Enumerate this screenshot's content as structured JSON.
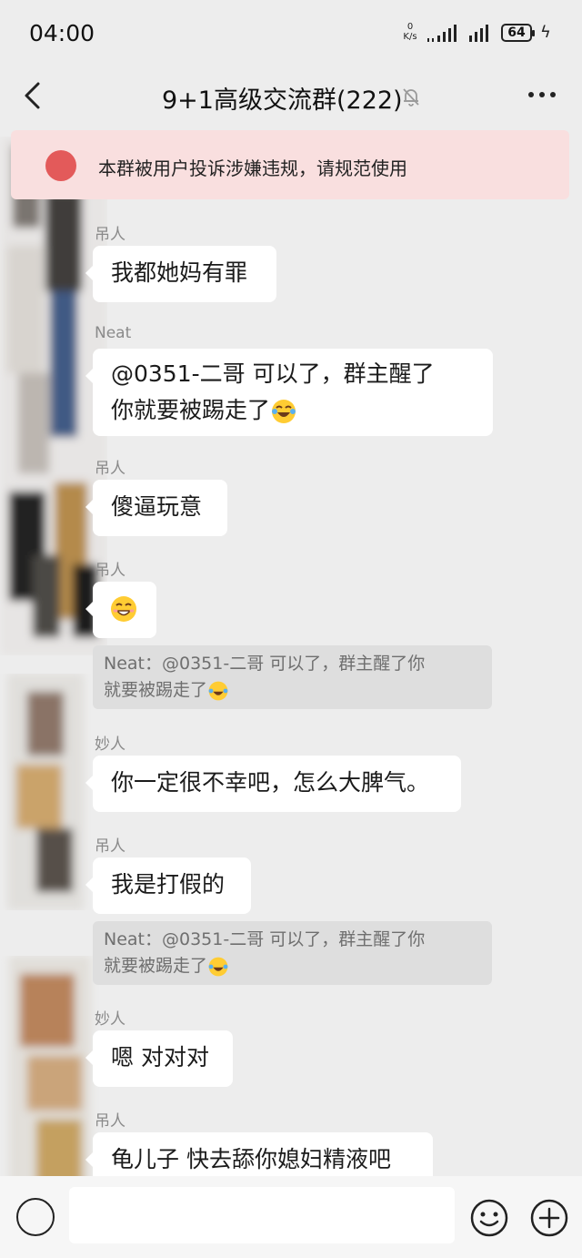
{
  "status": {
    "time": "04:00",
    "net_speed_value": "0",
    "net_speed_unit": "K/s",
    "battery": "64"
  },
  "header": {
    "title": "9+1高级交流群(222)"
  },
  "notice": {
    "text": "本群被用户投诉涉嫌违规，请规范使用"
  },
  "messages": [
    {
      "sender": "吊人",
      "text": "我都她妈有罪"
    },
    {
      "sender": "Neat",
      "line1": "@0351-二哥  可以了，群主醒了",
      "line2": "你就要被踢走了"
    },
    {
      "sender": "吊人",
      "text": "傻逼玩意"
    },
    {
      "sender": "吊人",
      "quote_line1": "Neat：@0351-二哥 可以了，群主醒了你",
      "quote_line2": "就要被踢走了"
    },
    {
      "sender": "妙人",
      "text": "你一定很不幸吧，怎么大脾气。"
    },
    {
      "sender": "吊人",
      "text": "我是打假的",
      "quote_line1": "Neat：@0351-二哥 可以了，群主醒了你",
      "quote_line2": "就要被踢走了"
    },
    {
      "sender": "妙人",
      "text": "嗯 对对对"
    },
    {
      "sender": "吊人",
      "text": "龟儿子 快去舔你媳妇精液吧"
    }
  ],
  "colors": {
    "background": "#ededed",
    "bubble": "#ffffff",
    "notice_bg": "#f9dfdf",
    "notice_icon": "#e35a5a",
    "quote_bg": "#dedede"
  },
  "icons": [
    "back-arrow-icon",
    "mute-bell-icon",
    "more-dots-icon",
    "voice-icon",
    "emoji-icon",
    "plus-icon",
    "laughing-tears-emoji",
    "grinning-sweat-emoji"
  ]
}
